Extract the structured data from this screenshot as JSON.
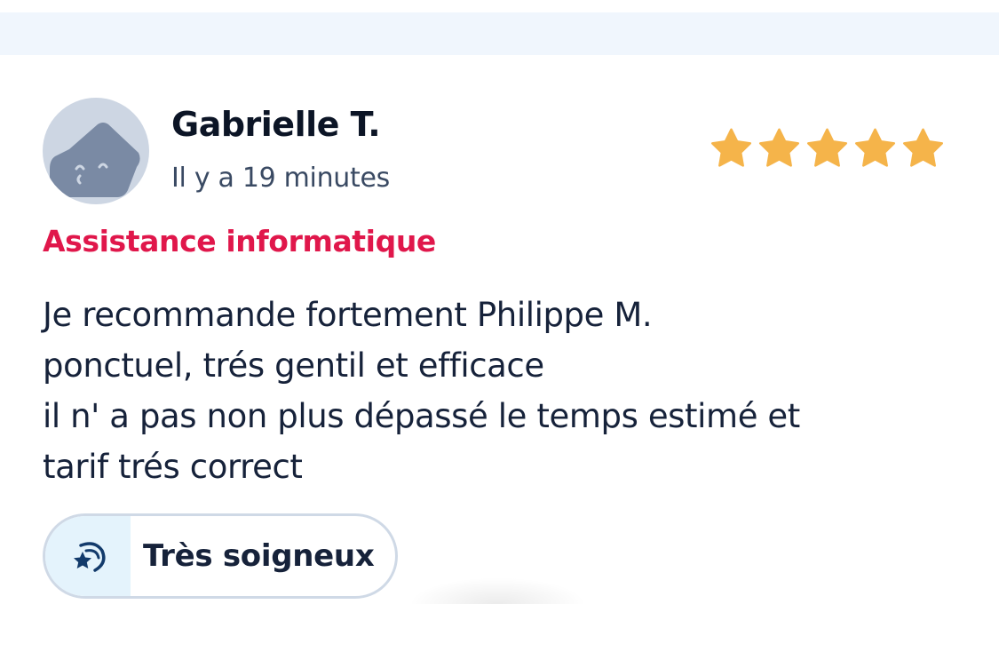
{
  "review": {
    "author_name": "Gabrielle T.",
    "time_ago": "Il y a 19 minutes",
    "rating": 5,
    "rating_max": 5,
    "category": "Assistance informatique",
    "text_lines": [
      "Je recommande fortement Philippe M.",
      "ponctuel, trés gentil et efficace",
      "il n' a pas non plus dépassé le temps estimé et",
      "tarif trés correct"
    ],
    "tag": {
      "label": "Très soigneux",
      "icon": "shooting-star-icon"
    }
  },
  "colors": {
    "star": "#f5b44a",
    "category": "#e0174b",
    "text": "#16223a",
    "top_band": "#f0f6fd",
    "avatar_bg": "#cdd6e3",
    "avatar_face": "#7a8aa4",
    "tag_border": "#cfd9e6",
    "tag_icon_bg": "#e4f3fc",
    "tag_icon": "#123a6b"
  }
}
